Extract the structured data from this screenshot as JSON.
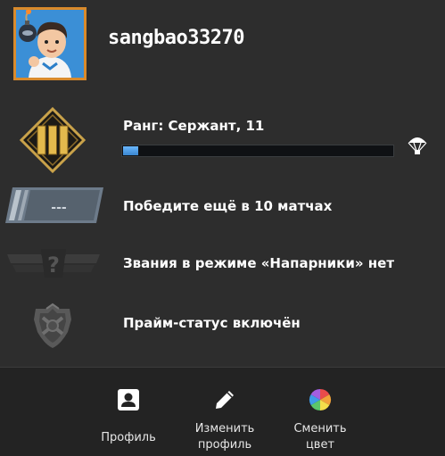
{
  "profile": {
    "username": "sangbao33270"
  },
  "rank": {
    "label": "Ранг: Сержант, 11",
    "progress_fraction": 0.055,
    "accent_color": "#4aa3f0"
  },
  "competitive": {
    "label": "Победите ещё в 10 матчах",
    "placeholder_rank": "---"
  },
  "wingman": {
    "label": "Звания в режиме «Напарники» нет",
    "icon_glyph": "?"
  },
  "prime": {
    "label": "Прайм-статус включён"
  },
  "footer": {
    "profile_label": "Профиль",
    "edit_label": "Изменить\nпрофиль",
    "color_label": "Сменить\nцвет"
  },
  "icons": {
    "avatar": "cartoon-avatar-with-bomb",
    "rank_badge": "gold-three-chevron-diamond-icon",
    "parachute": "parachute-icon",
    "competitive_badge": "empty-rank-plate-icon",
    "wingman_badge": "wingman-unranked-icon",
    "prime_badge": "prime-shield-icon",
    "profile": "person-card-icon",
    "edit": "pencil-icon",
    "color": "color-wheel-icon"
  }
}
